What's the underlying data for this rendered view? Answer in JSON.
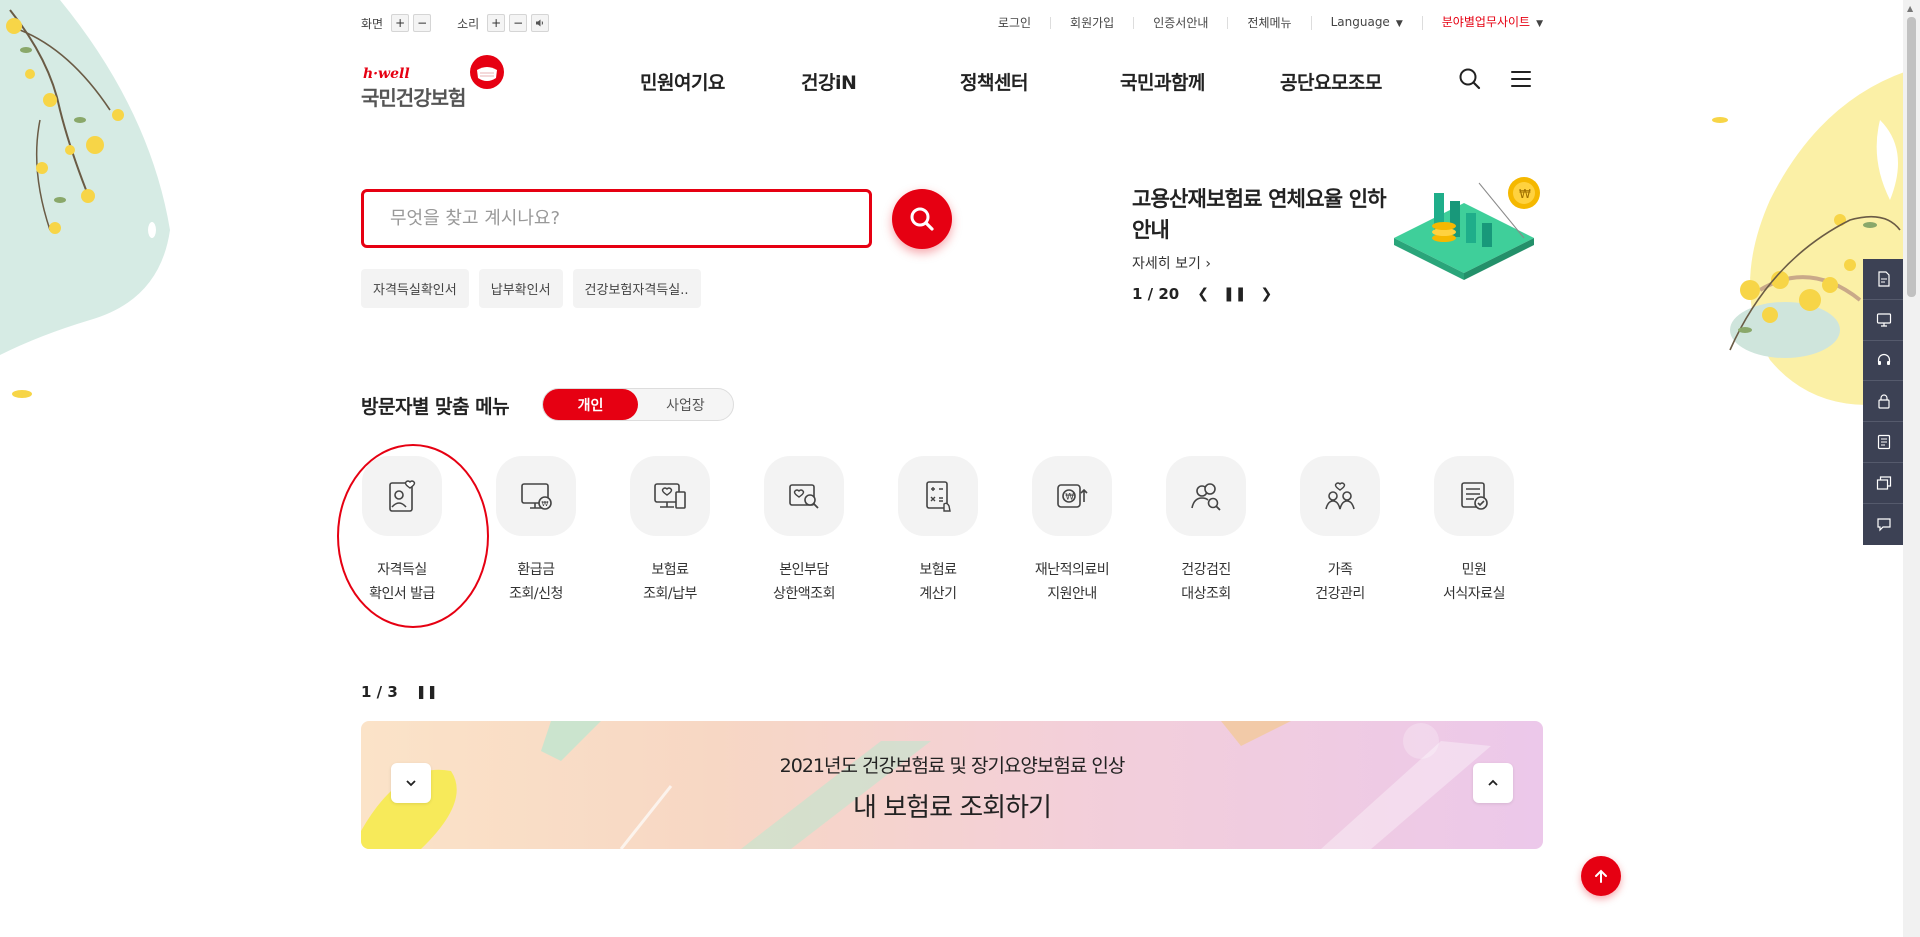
{
  "utility": {
    "screen_label": "화면",
    "sound_label": "소리",
    "plus": "+",
    "minus": "−",
    "links": {
      "login": "로그인",
      "signup": "회원가입",
      "cert": "인증서안내",
      "allmenu": "전체메뉴",
      "language": "Language",
      "sites": "분야별업무사이트"
    }
  },
  "logo": {
    "hwell": "h·well",
    "name": "국민건강보험"
  },
  "gnb": [
    "민원여기요",
    "건강iN",
    "정책센터",
    "국민과함께",
    "공단요모조모"
  ],
  "search": {
    "placeholder": "무엇을 찾고 계시나요?",
    "keywords": [
      "자격득실확인서",
      "납부확인서",
      "건강보험자격득실.."
    ]
  },
  "notice": {
    "title": "고용산재보험료 연체요율 인하 안내",
    "more": "자세히 보기",
    "page": "1 / 20"
  },
  "custom_menu": {
    "title": "방문자별 맞춤 메뉴",
    "tabs": [
      "개인",
      "사업장"
    ],
    "items": [
      {
        "label": "자격득실\n확인서 발급",
        "icon": "id-card-heart-icon"
      },
      {
        "label": "환급금\n조회/신청",
        "icon": "monitor-won-icon"
      },
      {
        "label": "보험료\n조회/납부",
        "icon": "monitor-heart-icon"
      },
      {
        "label": "본인부담\n상한액조회",
        "icon": "search-heart-icon"
      },
      {
        "label": "보험료\n계산기",
        "icon": "calculator-icon"
      },
      {
        "label": "재난적의료비\n지원안내",
        "icon": "won-up-icon"
      },
      {
        "label": "건강검진\n대상조회",
        "icon": "people-search-icon"
      },
      {
        "label": "가족\n건강관리",
        "icon": "family-heart-icon"
      },
      {
        "label": "민원\n서식자료실",
        "icon": "document-check-icon"
      }
    ]
  },
  "banner": {
    "page": "1 / 3",
    "subtitle": "2021년도 건강보험료 및 장기요양보험료 인상",
    "title": "내 보험료 조회하기"
  },
  "colors": {
    "brand_red": "#e60012",
    "quick_bar": "#3c4154"
  }
}
